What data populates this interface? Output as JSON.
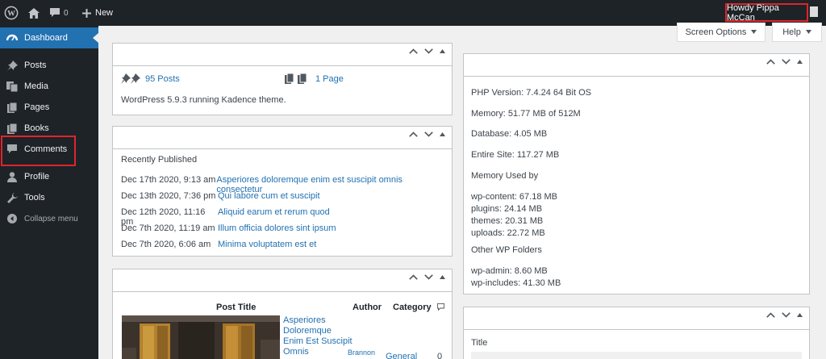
{
  "adminbar": {
    "comments_count": "0",
    "new_label": "New",
    "howdy": "Howdy Pippa McCan"
  },
  "sidebar": {
    "items": [
      {
        "label": "Dashboard",
        "icon": "dashboard-icon"
      },
      {
        "label": "Posts",
        "icon": "pushpin-icon"
      },
      {
        "label": "Media",
        "icon": "media-icon"
      },
      {
        "label": "Pages",
        "icon": "pages-icon"
      },
      {
        "label": "Books",
        "icon": "books-icon"
      },
      {
        "label": "Comments",
        "icon": "comment-icon"
      },
      {
        "label": "Profile",
        "icon": "user-icon"
      },
      {
        "label": "Tools",
        "icon": "wrench-icon"
      },
      {
        "label": "Collapse menu",
        "icon": "collapse-icon"
      }
    ]
  },
  "toptabs": {
    "screen_options": "Screen Options",
    "help": "Help"
  },
  "glance": {
    "posts": "95 Posts",
    "pages": "1 Page",
    "running": "WordPress 5.9.3 running Kadence theme."
  },
  "activity": {
    "heading": "Recently Published",
    "rows": [
      {
        "date": "Dec 17th 2020, 9:13 am",
        "title": "Asperiores doloremque enim est suscipit omnis consectetur"
      },
      {
        "date": "Dec 13th 2020, 7:36 pm",
        "title": "Qui labore cum et suscipit"
      },
      {
        "date": "Dec 12th 2020, 11:16 pm",
        "title": "Aliquid earum et rerum quod"
      },
      {
        "date": "Dec 7th 2020, 11:19 am",
        "title": "Illum officia dolores sint ipsum"
      },
      {
        "date": "Dec 7th 2020, 6:06 am",
        "title": "Minima voluptatem est et"
      }
    ]
  },
  "posts_table": {
    "headers": {
      "title": "Post Title",
      "author": "Author",
      "category": "Category"
    },
    "row": {
      "title_lines": [
        "Asperiores",
        "Doloremque",
        "Enim Est Suscipit",
        "Omnis"
      ],
      "author": "Brannon",
      "category": "General",
      "comments": "0"
    }
  },
  "sysinfo": {
    "php": "PHP Version: 7.4.24 64 Bit OS",
    "memory": "Memory: 51.77 MB of 512M",
    "database": "Database: 4.05 MB",
    "entire_site": "Entire Site: 117.27 MB",
    "memory_used_heading": "Memory Used by",
    "memory_used": [
      "wp-content: 67.18 MB",
      "plugins: 24.14 MB",
      "themes: 20.31 MB",
      "uploads: 22.72 MB"
    ],
    "other_heading": "Other WP Folders",
    "other": [
      "wp-admin: 8.60 MB",
      "wp-includes: 41.30 MB"
    ]
  },
  "bottom_right": {
    "title_label": "Title"
  }
}
